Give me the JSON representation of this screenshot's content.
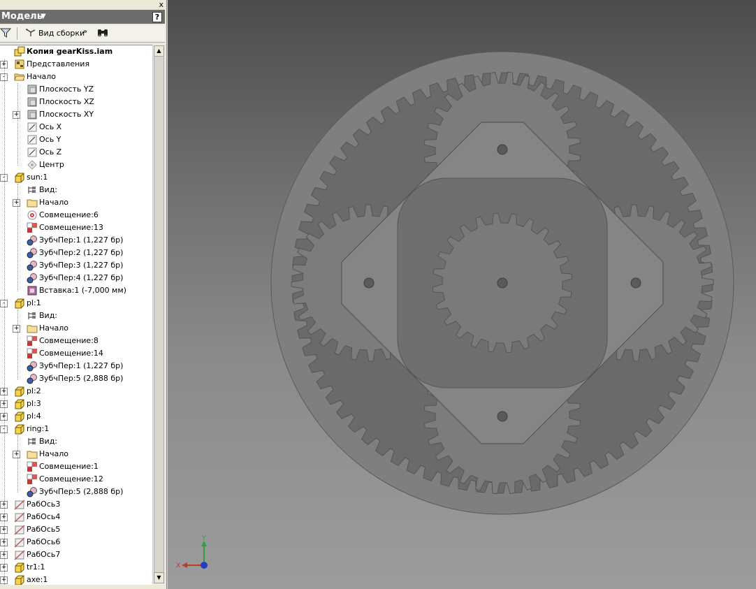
{
  "panel": {
    "title": "Модель",
    "help": "?",
    "close": "x"
  },
  "toolbar": {
    "view_label": "Вид сборки",
    "filter_icon": "filter-icon",
    "find_icon": "binoculars-icon"
  },
  "tree": [
    {
      "label": "Копия gearKiss.iam",
      "icon": "assembly",
      "level": 0,
      "exp": "",
      "bold": true
    },
    {
      "label": "Представления",
      "icon": "views",
      "level": 0,
      "exp": "+"
    },
    {
      "label": "Начало",
      "icon": "folder-open",
      "level": 0,
      "exp": "-"
    },
    {
      "label": "Плоскость YZ",
      "icon": "plane",
      "level": 1,
      "exp": ""
    },
    {
      "label": "Плоскость XZ",
      "icon": "plane",
      "level": 1,
      "exp": ""
    },
    {
      "label": "Плоскость XY",
      "icon": "plane",
      "level": 1,
      "exp": "+"
    },
    {
      "label": "Ось X",
      "icon": "axis",
      "level": 1,
      "exp": ""
    },
    {
      "label": "Ось Y",
      "icon": "axis",
      "level": 1,
      "exp": ""
    },
    {
      "label": "Ось Z",
      "icon": "axis",
      "level": 1,
      "exp": ""
    },
    {
      "label": "Центр",
      "icon": "point",
      "level": 1,
      "exp": ""
    },
    {
      "label": "sun:1",
      "icon": "part",
      "level": 0,
      "exp": "-"
    },
    {
      "label": "Вид:",
      "icon": "view",
      "level": 1,
      "exp": ""
    },
    {
      "label": "Начало",
      "icon": "folder",
      "level": 1,
      "exp": "+"
    },
    {
      "label": "Совмещение:6",
      "icon": "mate-circle",
      "level": 1,
      "exp": ""
    },
    {
      "label": "Совмещение:13",
      "icon": "mate",
      "level": 1,
      "exp": ""
    },
    {
      "label": "ЗубчПер:1 (1,227 бр)",
      "icon": "gear-constraint",
      "level": 1,
      "exp": ""
    },
    {
      "label": "ЗубчПер:2 (1,227 бр)",
      "icon": "gear-constraint",
      "level": 1,
      "exp": ""
    },
    {
      "label": "ЗубчПер:3 (1,227 бр)",
      "icon": "gear-constraint",
      "level": 1,
      "exp": ""
    },
    {
      "label": "ЗубчПер:4 (1,227 бр)",
      "icon": "gear-constraint",
      "level": 1,
      "exp": ""
    },
    {
      "label": "Вставка:1 (-7,000 мм)",
      "icon": "insert",
      "level": 1,
      "exp": ""
    },
    {
      "label": "pl:1",
      "icon": "part",
      "level": 0,
      "exp": "-"
    },
    {
      "label": "Вид:",
      "icon": "view",
      "level": 1,
      "exp": ""
    },
    {
      "label": "Начало",
      "icon": "folder",
      "level": 1,
      "exp": "+"
    },
    {
      "label": "Совмещение:8",
      "icon": "mate",
      "level": 1,
      "exp": ""
    },
    {
      "label": "Совмещение:14",
      "icon": "mate",
      "level": 1,
      "exp": ""
    },
    {
      "label": "ЗубчПер:1 (1,227 бр)",
      "icon": "gear-constraint",
      "level": 1,
      "exp": ""
    },
    {
      "label": "ЗубчПер:5 (2,888 бр)",
      "icon": "gear-constraint",
      "level": 1,
      "exp": ""
    },
    {
      "label": "pl:2",
      "icon": "part",
      "level": 0,
      "exp": "+"
    },
    {
      "label": "pl:3",
      "icon": "part",
      "level": 0,
      "exp": "+"
    },
    {
      "label": "pl:4",
      "icon": "part",
      "level": 0,
      "exp": "+"
    },
    {
      "label": "ring:1",
      "icon": "part",
      "level": 0,
      "exp": "-"
    },
    {
      "label": "Вид:",
      "icon": "view",
      "level": 1,
      "exp": ""
    },
    {
      "label": "Начало",
      "icon": "folder",
      "level": 1,
      "exp": "+"
    },
    {
      "label": "Совмещение:1",
      "icon": "mate",
      "level": 1,
      "exp": ""
    },
    {
      "label": "Совмещение:12",
      "icon": "mate",
      "level": 1,
      "exp": ""
    },
    {
      "label": "ЗубчПер:5 (2,888 бр)",
      "icon": "gear-constraint",
      "level": 1,
      "exp": ""
    },
    {
      "label": "РабОсь3",
      "icon": "work-axis",
      "level": 0,
      "exp": "+"
    },
    {
      "label": "РабОсь4",
      "icon": "work-axis",
      "level": 0,
      "exp": "+"
    },
    {
      "label": "РабОсь5",
      "icon": "work-axis",
      "level": 0,
      "exp": "+"
    },
    {
      "label": "РабОсь6",
      "icon": "work-axis",
      "level": 0,
      "exp": "+"
    },
    {
      "label": "РабОсь7",
      "icon": "work-axis",
      "level": 0,
      "exp": "+"
    },
    {
      "label": "tr1:1",
      "icon": "part",
      "level": 0,
      "exp": "+"
    },
    {
      "label": "axe:1",
      "icon": "part",
      "level": 0,
      "exp": "+"
    }
  ],
  "viewport": {
    "triad_x": "X",
    "triad_y": "Y"
  },
  "colors": {
    "panel_title_bg": "#6d6d6d",
    "part_fill": "#7a7a7a",
    "axis_x": "#c0392b",
    "axis_y": "#2ea043",
    "axis_z": "#1f3fbf"
  }
}
